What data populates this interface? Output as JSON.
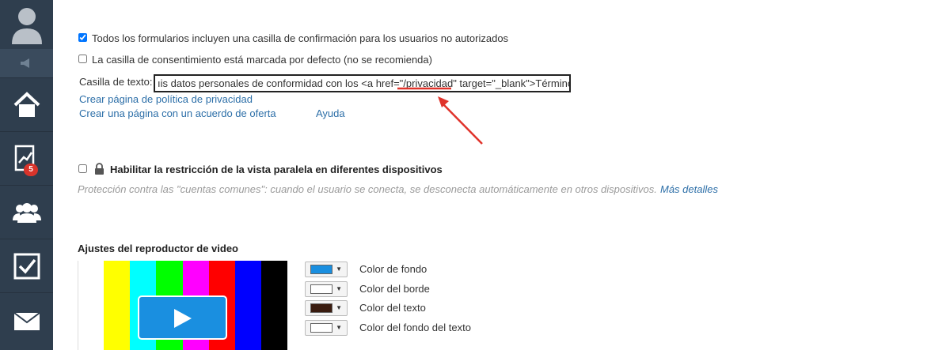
{
  "sidebar": {
    "items": [
      {
        "name": "user-avatar",
        "icon": "user-icon"
      },
      {
        "name": "announcements",
        "icon": "megaphone-icon"
      },
      {
        "name": "home",
        "icon": "home-icon"
      },
      {
        "name": "analytics",
        "icon": "chart-icon",
        "badge": "5"
      },
      {
        "name": "users",
        "icon": "users-icon"
      },
      {
        "name": "tasks",
        "icon": "checkbox-icon"
      },
      {
        "name": "mail",
        "icon": "mail-icon"
      }
    ]
  },
  "consent": {
    "all_forms_label": "Todos los formularios incluyen una casilla de confirmación para los usuarios no autorizados",
    "all_forms_checked": true,
    "default_checked_label": "La casilla de consentimiento está marcada por defecto (no se recomienda)",
    "default_checked": false,
    "textbox_label": "Casilla de texto:",
    "textbox_value_pre": "ıis datos personales de conformidad con los <a href=\"",
    "textbox_value_highlight": "/privacidad",
    "textbox_value_post": "\" target=\"_blank\">Términos",
    "link_privacy": "Crear página de política de privacidad",
    "link_offer": "Crear una página con un acuerdo de oferta",
    "link_help": "Ayuda"
  },
  "parallel_view": {
    "label": "Habilitar la restricción de la vista paralela en diferentes dispositivos",
    "checked": false,
    "hint": "Protección contra las \"cuentas comunes\": cuando el usuario se conecta, se desconecta automáticamente en otros dispositivos.",
    "more_link": "Más detalles"
  },
  "video_player": {
    "title": "Ajustes del reproductor de video",
    "color_options": [
      {
        "label": "Color de fondo",
        "color": "#1a8fe0"
      },
      {
        "label": "Color del borde",
        "color": "#ffffff"
      },
      {
        "label": "Color del texto",
        "color": "#3a1c10"
      },
      {
        "label": "Color del fondo del texto",
        "color": "#ffffff"
      }
    ],
    "test_bars": [
      "#ffffff",
      "#ffff00",
      "#00ffff",
      "#00ff00",
      "#ff00ff",
      "#ff0000",
      "#0000ff",
      "#000000"
    ],
    "play_button_color": "#1a8fe0"
  },
  "annotation": {
    "color": "#e0332b"
  }
}
